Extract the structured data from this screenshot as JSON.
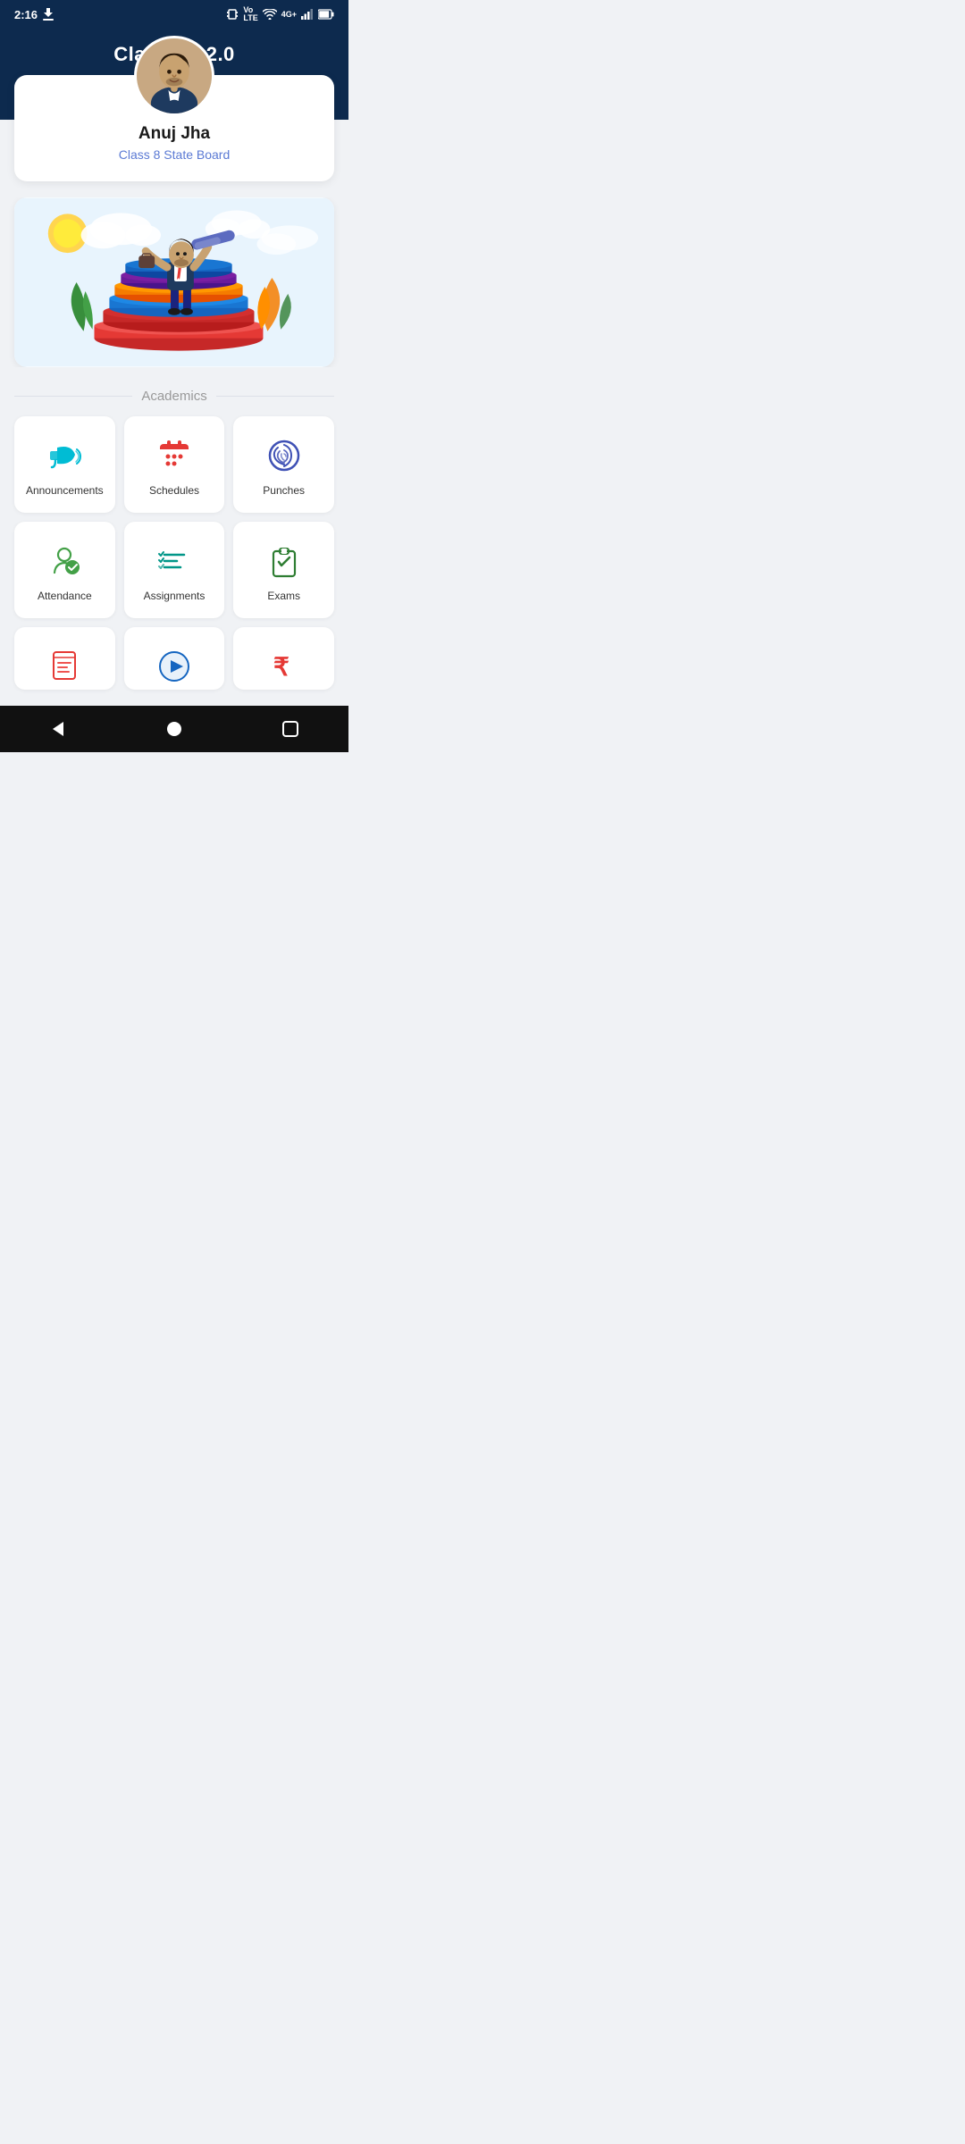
{
  "statusBar": {
    "time": "2:16",
    "signals": [
      "vibrate",
      "volte",
      "wifi",
      "4g",
      "signal",
      "battery"
    ]
  },
  "header": {
    "title": "Classbot 2.0"
  },
  "profile": {
    "name": "Anuj Jha",
    "class": "Class 8 State Board"
  },
  "sections": {
    "academics": {
      "label": "Academics",
      "items": [
        {
          "id": "announcements",
          "label": "Announcements",
          "color": "#00bcd4"
        },
        {
          "id": "schedules",
          "label": "Schedules",
          "color": "#e53935"
        },
        {
          "id": "punches",
          "label": "Punches",
          "color": "#3f51b5"
        },
        {
          "id": "attendance",
          "label": "Attendance",
          "color": "#43a047"
        },
        {
          "id": "assignments",
          "label": "Assignments",
          "color": "#009688"
        },
        {
          "id": "exams",
          "label": "Exams",
          "color": "#2e7d32"
        }
      ],
      "partialItems": [
        {
          "id": "results",
          "label": "",
          "color": "#e53935"
        },
        {
          "id": "media",
          "label": "",
          "color": "#1565c0"
        },
        {
          "id": "fees",
          "label": "",
          "color": "#e53935"
        }
      ]
    }
  },
  "bottomNav": {
    "back": "◀",
    "home": "●",
    "recent": "■"
  }
}
